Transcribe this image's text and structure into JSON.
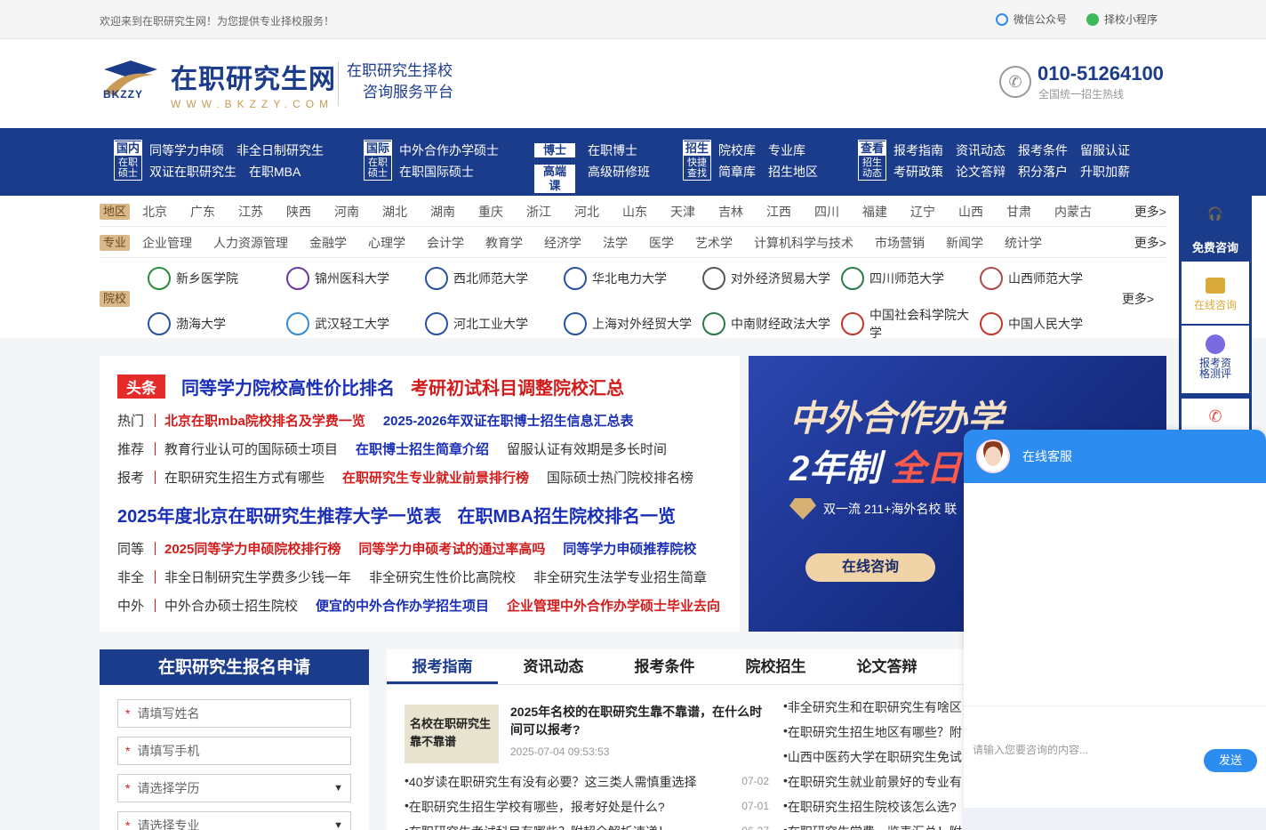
{
  "topbar": {
    "welcome": "欢迎来到在职研究生网！为您提供专业择校服务！",
    "wechat": "微信公众号",
    "mini": "择校小程序"
  },
  "header": {
    "brand_cn": "在职研究生网",
    "brand_en": "WWW.BKZZY.COM",
    "logo_text": "BKZZY",
    "slogan1": "在职研究生择校",
    "slogan2": "咨询服务平台",
    "phone": "010-51264100",
    "phone_sub": "全国统一招生热线"
  },
  "nav": [
    {
      "tag_top": "国内",
      "tag_bottom": "在职硕士",
      "row1": [
        "同等学力申硕",
        "非全日制研究生"
      ],
      "row2": [
        "双证在职研究生",
        "在职MBA"
      ]
    },
    {
      "tag_top": "国际",
      "tag_bottom": "在职硕士",
      "row1": [
        "中外合作办学硕士"
      ],
      "row2": [
        "在职国际硕士"
      ]
    },
    {
      "tag_top": "博士",
      "tag_bottom": "高端课",
      "row1": [
        "在职博士"
      ],
      "row2": [
        "高级研修班"
      ]
    },
    {
      "tag_top": "招生",
      "tag_bottom": "快捷查找",
      "row1": [
        "院校库",
        "专业库"
      ],
      "row2": [
        "简章库",
        "招生地区"
      ]
    },
    {
      "tag_top": "查看",
      "tag_bottom": "招生动态",
      "row1": [
        "报考指南",
        "资讯动态",
        "报考条件",
        "留服认证"
      ],
      "row2": [
        "考研政策",
        "论文答辩",
        "积分落户",
        "升职加薪"
      ]
    }
  ],
  "filter": {
    "region_label": "地区",
    "regions": [
      "北京",
      "广东",
      "江苏",
      "陕西",
      "河南",
      "湖北",
      "湖南",
      "重庆",
      "浙江",
      "河北",
      "山东",
      "天津",
      "吉林",
      "江西",
      "四川",
      "福建",
      "辽宁",
      "山西",
      "甘肃",
      "内蒙古"
    ],
    "major_label": "专业",
    "majors": [
      "企业管理",
      "人力资源管理",
      "金融学",
      "心理学",
      "会计学",
      "教育学",
      "经济学",
      "法学",
      "医学",
      "艺术学",
      "计算机科学与技术",
      "市场营销",
      "新闻学",
      "统计学"
    ],
    "school_label": "院校",
    "more": "更多>",
    "schools": [
      "新乡医学院",
      "锦州医科大学",
      "西北师范大学",
      "华北电力大学",
      "对外经济贸易大学",
      "四川师范大学",
      "山西师范大学",
      "渤海大学",
      "武汉轻工大学",
      "河北工业大学",
      "上海对外经贸大学",
      "中南财经政法大学",
      "中国社会科学院大学",
      "中国人民大学"
    ]
  },
  "news": {
    "badge": "头条",
    "head1": [
      "同等学力院校高性价比排名",
      "考研初试科目调整院校汇总"
    ],
    "rows1": [
      {
        "cat": "热门",
        "items": [
          {
            "t": "北京在职mba院校排名及学费一览",
            "c": "red"
          },
          {
            "t": "2025-2026年双证在职博士招生信息汇总表",
            "c": "blue"
          }
        ]
      },
      {
        "cat": "推荐",
        "items": [
          {
            "t": "教育行业认可的国际硕士项目",
            "c": ""
          },
          {
            "t": "在职博士招生简章介绍",
            "c": "blue"
          },
          {
            "t": "留服认证有效期是多长时间",
            "c": ""
          }
        ]
      },
      {
        "cat": "报考",
        "items": [
          {
            "t": "在职研究生招生方式有哪些",
            "c": ""
          },
          {
            "t": "在职研究生专业就业前景排行榜",
            "c": "red"
          },
          {
            "t": "国际硕士热门院校排名榜",
            "c": ""
          }
        ]
      }
    ],
    "head2": [
      "2025年度北京在职研究生推荐大学一览表",
      "在职MBA招生院校排名一览"
    ],
    "rows2": [
      {
        "cat": "同等",
        "items": [
          {
            "t": "2025同等学力申硕院校排行榜",
            "c": "red"
          },
          {
            "t": "同等学力申硕考试的通过率高吗",
            "c": "red"
          },
          {
            "t": "同等学力申硕推荐院校",
            "c": "blue"
          }
        ]
      },
      {
        "cat": "非全",
        "items": [
          {
            "t": "非全日制研究生学费多少钱一年",
            "c": ""
          },
          {
            "t": "非全研究生性价比高院校",
            "c": ""
          },
          {
            "t": "非全研究生法学专业招生简章",
            "c": ""
          }
        ]
      },
      {
        "cat": "中外",
        "items": [
          {
            "t": "中外合办硕士招生院校",
            "c": ""
          },
          {
            "t": "便宜的中外合作办学招生项目",
            "c": "blue"
          },
          {
            "t": "企业管理中外合作办学硕士毕业去向",
            "c": "red"
          }
        ]
      }
    ]
  },
  "banner": {
    "title": "中外合作办学",
    "sub1": "2年制 ",
    "sub2": "全日",
    "tagline": "双一流 211+海外名校  联",
    "btn": "在线咨询"
  },
  "form": {
    "title": "在职研究生报名申请",
    "name": "请填写姓名",
    "phone": "请填写手机",
    "edu": "请选择学历",
    "major": "请选择专业",
    "star": "*"
  },
  "tabs": {
    "items": [
      "报考指南",
      "资讯动态",
      "报考条件",
      "院校招生",
      "论文答辩"
    ],
    "feature": {
      "thumb1": "名校在职研究生",
      "thumb2": "靠不靠谱",
      "title": "2025年名校的在职研究生靠不靠谱，在什么时间可以报考?",
      "date": "2025-07-04 09:53:53"
    },
    "left": [
      {
        "t": "40岁读在职研究生有没有必要？这三类人需慎重选择",
        "d": "07-02"
      },
      {
        "t": "在职研究生招生学校有哪些，报考好处是什么?",
        "d": "07-01"
      },
      {
        "t": "在职研究生考试科目有哪些？附超全解析速递！",
        "d": "06-27"
      }
    ],
    "right": [
      "非全研究生和在职研究生有啥区",
      "在职研究生招生地区有哪些？附",
      "山西中医药大学在职研究生免试",
      "在职研究生就业前景好的专业有",
      "在职研究生招生院校该怎么选?",
      "在职研究生学费一览表汇总！附"
    ]
  },
  "side": {
    "free": "免费咨询",
    "online": "在线咨询",
    "eval": "报考资格测评"
  },
  "chat": {
    "title": "在线客服",
    "placeholder": "请输入您要咨询的内容...",
    "send": "发送"
  }
}
